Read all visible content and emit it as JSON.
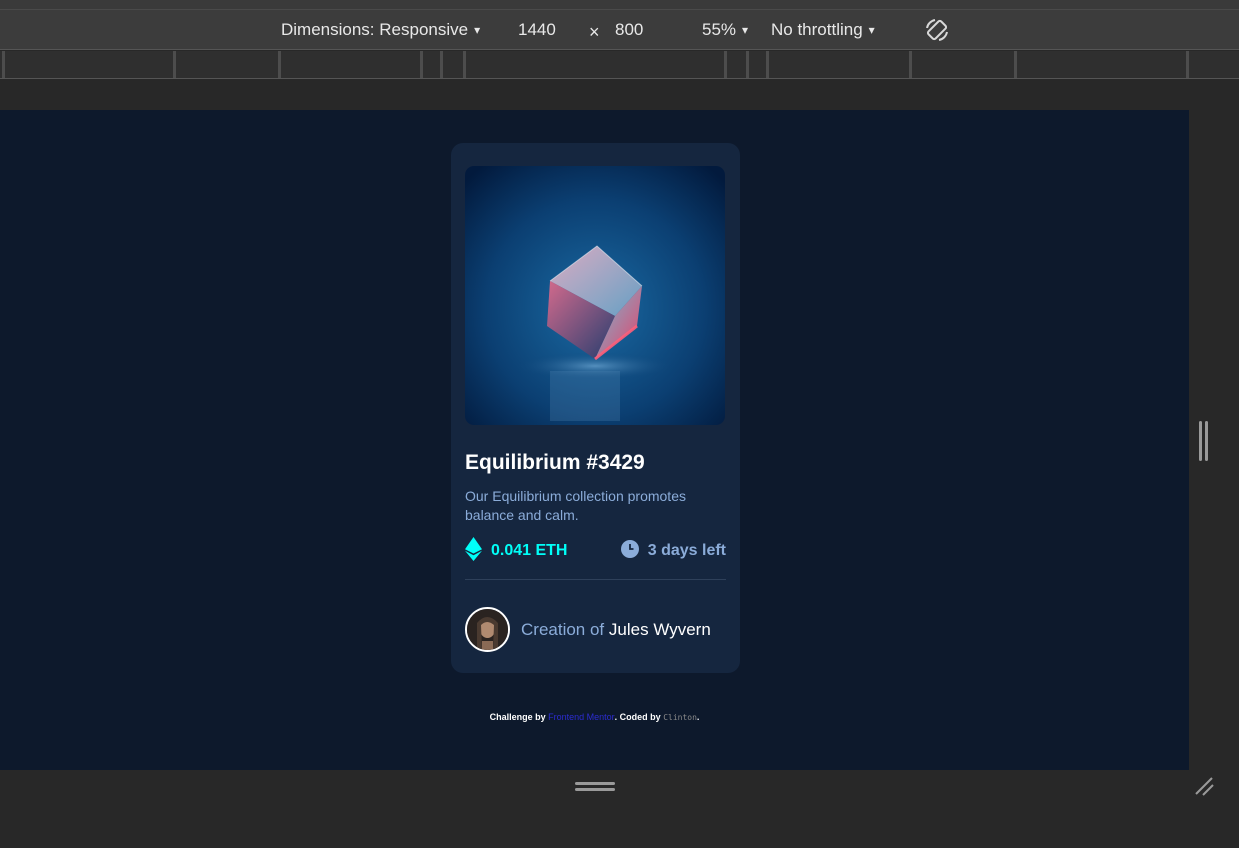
{
  "toolbar": {
    "dimensions_label": "Dimensions: Responsive",
    "width": "1440",
    "times": "×",
    "height": "800",
    "zoom": "55%",
    "throttle": "No throttling",
    "caret": "▾",
    "rotate_icon": "rotate-icon"
  },
  "card": {
    "title": "Equilibrium #3429",
    "description": "Our Equilibrium collection promotes balance and calm.",
    "price": "0.041 ETH",
    "time_left": "3 days left",
    "creator_prefix": "Creation of",
    "creator_name": "Jules Wyvern",
    "icons": {
      "price": "ethereum-icon",
      "time": "clock-icon",
      "image": "crystal-cube-image",
      "avatar": "creator-avatar"
    }
  },
  "attribution": {
    "prefix": "Challenge by",
    "link": "Frontend Mentor",
    "middle": ". Coded by",
    "author": "Clinton",
    "suffix": "."
  },
  "colors": {
    "background": "#0d192c",
    "card": "#15263f",
    "cyan": "#00fff8",
    "soft_blue": "#8bacd9",
    "white": "#ffffff"
  }
}
